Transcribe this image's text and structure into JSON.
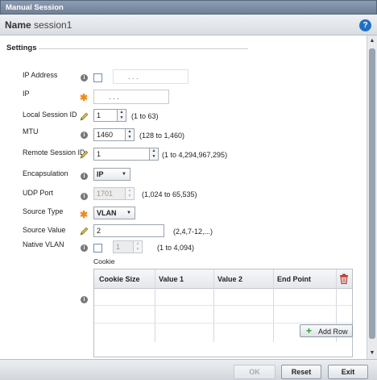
{
  "window": {
    "title": "Manual Session"
  },
  "name_bar": {
    "label": "Name",
    "value": "session1",
    "help": "?"
  },
  "settings": {
    "title": "Settings",
    "ip_address": {
      "label": "IP Address",
      "value": ".        .        ."
    },
    "ip": {
      "label": "IP",
      "value": ".        .        ."
    },
    "local_session_id": {
      "label": "Local Session ID",
      "value": "1",
      "hint": "(1 to 63)"
    },
    "mtu": {
      "label": "MTU",
      "value": "1460",
      "hint": "(128 to 1,460)"
    },
    "remote_session_id": {
      "label": "Remote Session ID",
      "value": "1",
      "hint": "(1 to 4,294,967,295)"
    },
    "encapsulation": {
      "label": "Encapsulation",
      "value": "IP"
    },
    "udp_port": {
      "label": "UDP Port",
      "value": "1701",
      "hint": "(1,024 to 65,535)"
    },
    "source_type": {
      "label": "Source Type",
      "value": "VLAN"
    },
    "source_value": {
      "label": "Source Value",
      "value": "2",
      "hint": "(2,4,7-12,...)"
    },
    "native_vlan": {
      "label": "Native VLAN",
      "value": "1",
      "hint": "(1 to 4,094)"
    }
  },
  "cookie": {
    "label": "Cookie",
    "columns": [
      "Cookie Size",
      "Value 1",
      "Value 2",
      "End Point"
    ],
    "add_row": "Add Row"
  },
  "footer": {
    "ok": "OK",
    "reset": "Reset",
    "exit": "Exit"
  },
  "colors": {
    "required": "#f08a1a",
    "accent": "#1f6fc7",
    "add": "#2f9b2f",
    "delete": "#c0392b"
  }
}
